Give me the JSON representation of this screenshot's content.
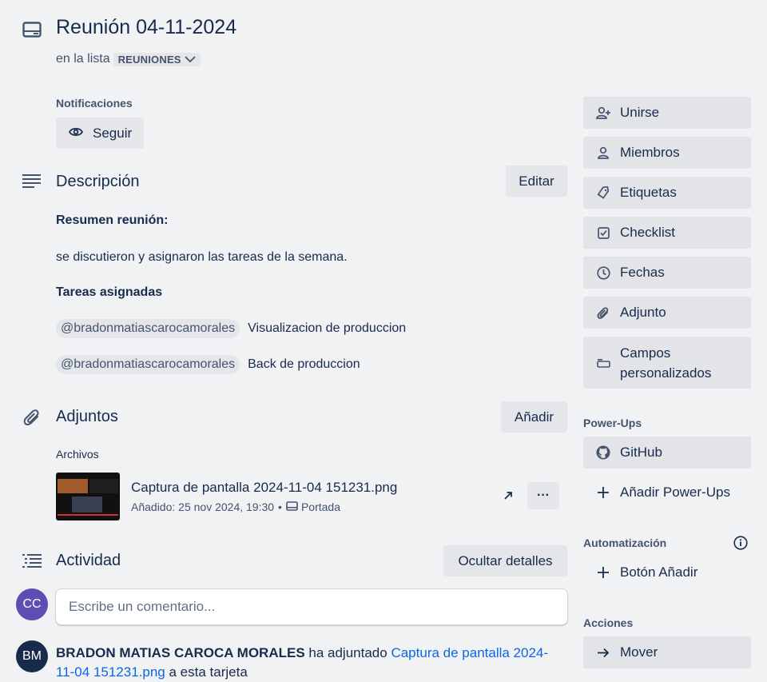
{
  "card": {
    "title": "Reunión 04-11-2024",
    "in_list_prefix": "en la lista",
    "list_name": "REUNIONES"
  },
  "notifications": {
    "label": "Notificaciones",
    "follow_button": "Seguir"
  },
  "description": {
    "heading": "Descripción",
    "edit_button": "Editar",
    "summary_title": "Resumen reunión:",
    "summary_text": "se discutieron y asignaron las tareas de la semana.",
    "tasks_title": "Tareas asignadas",
    "tasks": [
      {
        "mention": "@bradonmatiascarocamorales",
        "task": "Visualizacion de produccion"
      },
      {
        "mention": "@bradonmatiascarocamorales",
        "task": "Back de produccion"
      }
    ]
  },
  "attachments": {
    "heading": "Adjuntos",
    "add_button": "Añadir",
    "files_label": "Archivos",
    "file": {
      "name": "Captura de pantalla 2024-11-04 151231.png",
      "added": "Añadido: 25 nov 2024, 19:30",
      "separator": "•",
      "cover_label": "Portada",
      "more_label": "···"
    }
  },
  "activity": {
    "heading": "Actividad",
    "hide_details_button": "Ocultar detalles",
    "current_user_initials": "CC",
    "comment_placeholder": "Escribe un comentario...",
    "entry": {
      "initials": "BM",
      "user": "BRADON MATIAS CAROCA MORALES",
      "action": "ha adjuntado",
      "link": "Captura de pantalla 2024-",
      "link_rest": "11-04 151231.png",
      "suffix": "a esta tarjeta"
    }
  },
  "sidebar": {
    "add_to_card": [
      {
        "label": "Unirse",
        "icon": "user-plus-icon"
      },
      {
        "label": "Miembros",
        "icon": "user-icon"
      },
      {
        "label": "Etiquetas",
        "icon": "tag-icon"
      },
      {
        "label": "Checklist",
        "icon": "checkbox-icon"
      },
      {
        "label": "Fechas",
        "icon": "clock-icon"
      },
      {
        "label": "Adjunto",
        "icon": "paperclip-icon"
      }
    ],
    "custom_fields_line1": "Campos",
    "custom_fields_line2": "personalizados",
    "powerups_label": "Power-Ups",
    "github_label": "GitHub",
    "add_powerups_label": "Añadir Power-Ups",
    "automation_label": "Automatización",
    "add_button_label": "Botón Añadir",
    "actions_label": "Acciones",
    "move_label": "Mover"
  },
  "colors": {
    "background": "#f1f2f4",
    "button": "#e4e6ea",
    "text": "#172b4d",
    "subtle": "#44546f",
    "link": "#0c66e4",
    "avatar_cc": "#5e4db2",
    "avatar_bm": "#172b4d"
  }
}
